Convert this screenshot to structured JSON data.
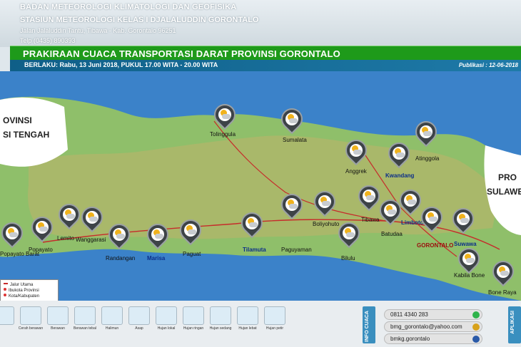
{
  "header": {
    "line1": "BADAN METEOROLOGI KLIMATOLOGI DAN GEOFISIKA",
    "line2": "STASIUN METEOROLOGI KELAS I DJALALUDDIN GORONTALO",
    "address": "Jalan Jalaluddin Tantu, Tibawa - Kab. Gorontalo 96251",
    "phone": "Telp (0435) 890393"
  },
  "title": "PRAKIRAAN CUACA TRANSPORTASI DARAT PROVINSI GORONTALO",
  "berlaku": "BERLAKU: Rabu, 13 Juni 2018, PUKUL 17.00 WITA - 20.00 WITA",
  "publikasi": "Publikasi : 12-06-2018",
  "regions": {
    "left": [
      "PROVINSI",
      "SULAWESI TENGAH"
    ],
    "left_visible": [
      "OVINSI",
      "SI TENGAH"
    ],
    "right": [
      "PRO",
      "SULAWE"
    ]
  },
  "cities": [
    {
      "name": "Tolinggula",
      "style": "plain"
    },
    {
      "name": "Sumalata",
      "style": "plain"
    },
    {
      "name": "Anggrek",
      "style": "plain"
    },
    {
      "name": "Kwandang",
      "style": "blue"
    },
    {
      "name": "Atinggola",
      "style": "plain"
    },
    {
      "name": "Paguyaman",
      "style": "plain"
    },
    {
      "name": "Boliyohuto",
      "style": "plain"
    },
    {
      "name": "Tibawa",
      "style": "plain"
    },
    {
      "name": "Batudaa",
      "style": "plain"
    },
    {
      "name": "Limboto",
      "style": "blue"
    },
    {
      "name": "GORONTALO",
      "style": "red"
    },
    {
      "name": "Suwawa",
      "style": "blue"
    },
    {
      "name": "Kabila Bone",
      "style": "plain"
    },
    {
      "name": "Bone Raya",
      "style": "plain"
    },
    {
      "name": "Bilulu",
      "style": "plain"
    },
    {
      "name": "Tilamuta",
      "style": "blue"
    },
    {
      "name": "Paguat",
      "style": "plain"
    },
    {
      "name": "Marisa",
      "style": "blue"
    },
    {
      "name": "Randangan",
      "style": "plain"
    },
    {
      "name": "Wanggarasi",
      "style": "plain"
    },
    {
      "name": "Lemito",
      "style": "plain"
    },
    {
      "name": "Popayato",
      "style": "plain"
    },
    {
      "name": "Popayato Barat",
      "style": "plain"
    }
  ],
  "legend": {
    "items": [
      "Jalur Utama",
      "Ibukota Provinsi",
      "Kota/Kabupaten"
    ]
  },
  "weather_legend": [
    {
      "label": "",
      "icon": "sunny-icon"
    },
    {
      "label": "Cerah berawan",
      "icon": "partly-sunny-icon"
    },
    {
      "label": "Berawan",
      "icon": "cloudy-icon"
    },
    {
      "label": "Berawan tebal",
      "icon": "overcast-icon"
    },
    {
      "label": "Halimun",
      "icon": "mist-icon"
    },
    {
      "label": "Asap",
      "icon": "smoke-icon"
    },
    {
      "label": "Hujan lokal",
      "icon": "local-rain-icon"
    },
    {
      "label": "Hujan ringan",
      "icon": "light-rain-icon"
    },
    {
      "label": "Hujan sedang",
      "icon": "moderate-rain-icon"
    },
    {
      "label": "Hujan lebat",
      "icon": "heavy-rain-icon"
    },
    {
      "label": "Hujan petir",
      "icon": "thunderstorm-icon"
    }
  ],
  "info_tab": "INFO CUACA",
  "apps_tab": "APLIKASI",
  "contacts": [
    {
      "text": "0811 4340 283",
      "icon": "whatsapp-icon",
      "color": "#2fb34a"
    },
    {
      "text": "bmg_gorontalo@yahoo.com",
      "icon": "email-icon",
      "color": "#d8a21b"
    },
    {
      "text": "bmkg.gorontalo",
      "icon": "facebook-icon",
      "color": "#2a5aa8"
    }
  ]
}
